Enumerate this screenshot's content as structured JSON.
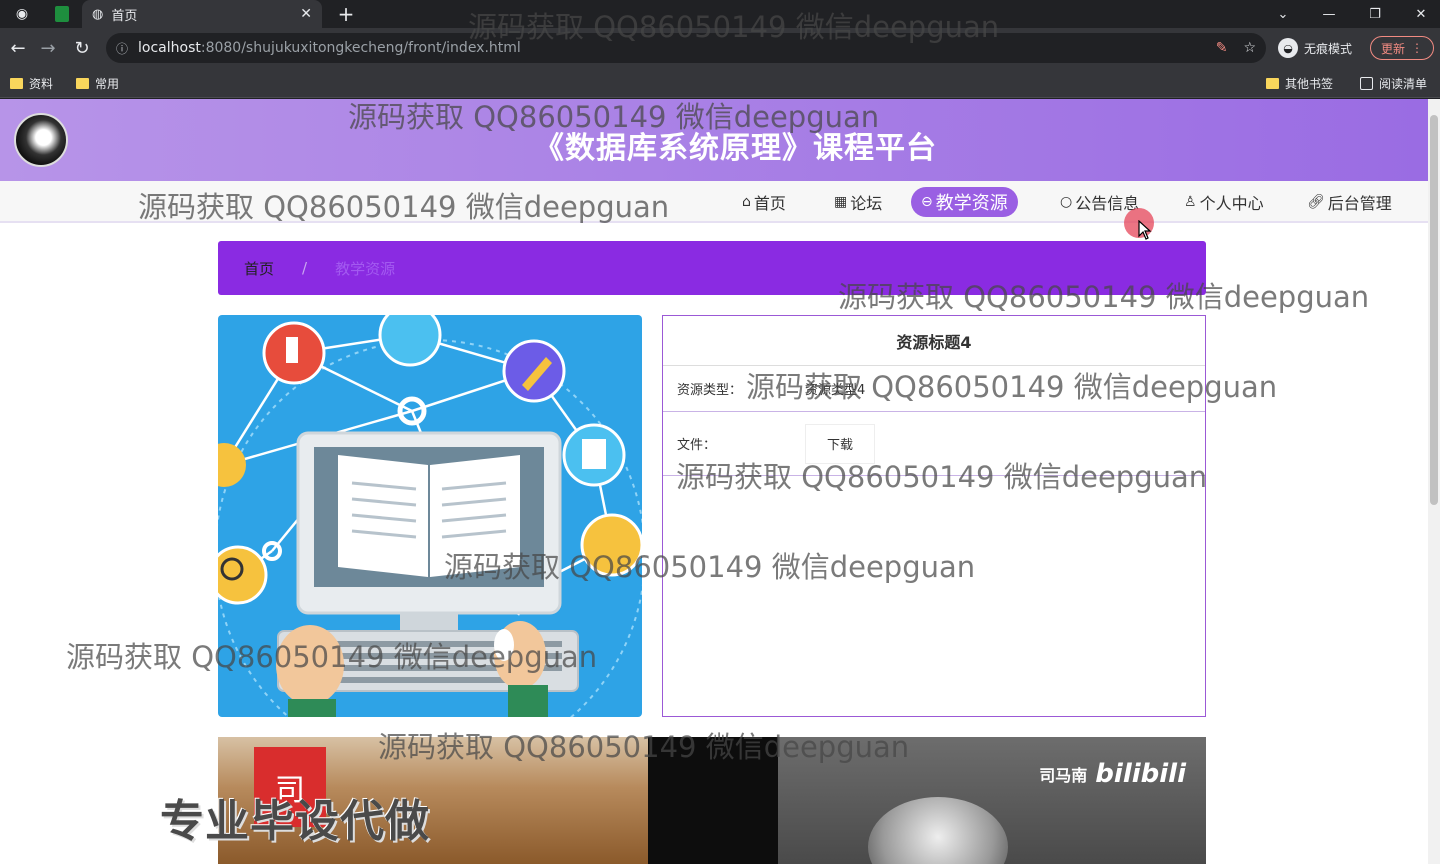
{
  "browser": {
    "tab_title": "首页",
    "url_host": "localhost",
    "url_rest": ":8080/shujukuxitongkecheng/front/index.html",
    "incognito_label": "无痕模式",
    "update_label": "更新",
    "bookmarks": [
      "资料",
      "常用"
    ],
    "other_bookmarks": "其他书签",
    "reading_list": "阅读清单"
  },
  "site": {
    "title": "《数据库系统原理》课程平台",
    "nav": [
      {
        "label": "首页",
        "icon": "home-icon"
      },
      {
        "label": "论坛",
        "icon": "grid-icon"
      },
      {
        "label": "教学资源",
        "icon": "resource-icon"
      },
      {
        "label": "公告信息",
        "icon": "notice-icon"
      },
      {
        "label": "个人中心",
        "icon": "user-icon"
      },
      {
        "label": "后台管理",
        "icon": "link-icon"
      }
    ],
    "active_nav": "教学资源"
  },
  "breadcrumb": {
    "home": "首页",
    "separator": "/",
    "current": "教学资源"
  },
  "detail": {
    "title": "资源标题4",
    "type_label": "资源类型：",
    "type_value": "资源类型4",
    "file_label": "文件：",
    "download_label": "下载"
  },
  "video": {
    "badge": "司",
    "brand_name": "司马南",
    "brand_logo": "bilibili",
    "promo": "专业毕设代做"
  },
  "watermark": "源码获取 QQ86050149 微信deepguan",
  "colors": {
    "header_start": "#b794e8",
    "header_end": "#9a6ce3",
    "breadcrumb_bg": "#8a2be2",
    "active_nav": "#9a5fe3"
  }
}
